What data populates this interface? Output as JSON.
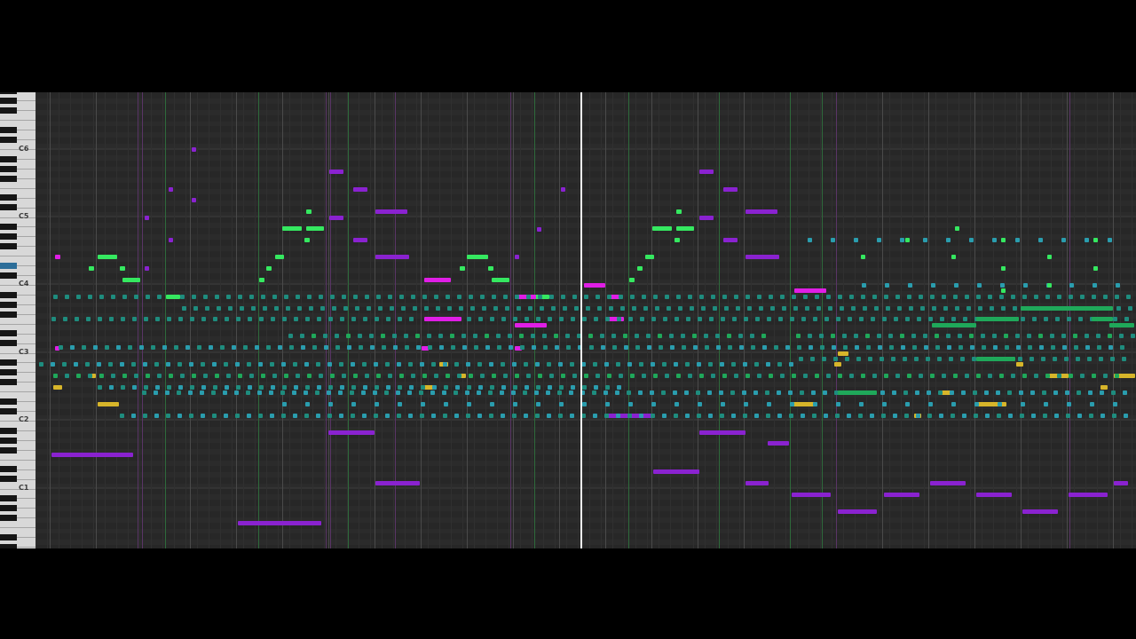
{
  "view": "piano-roll",
  "octave_labels": [
    "C6",
    "C5",
    "C4",
    "C3",
    "C2",
    "C1"
  ],
  "colors": {
    "bright_green": "#35e860",
    "green": "#1fa85a",
    "teal": "#1e8c7e",
    "cyan": "#2a9dae",
    "magenta": "#e01ee6",
    "purple": "#8a22d0",
    "gold": "#d7b52a",
    "playhead": "#f4f4f4"
  },
  "playhead_label": "playhead",
  "notes_summary": "multi-track MIDI notes across octaves C1–C6"
}
